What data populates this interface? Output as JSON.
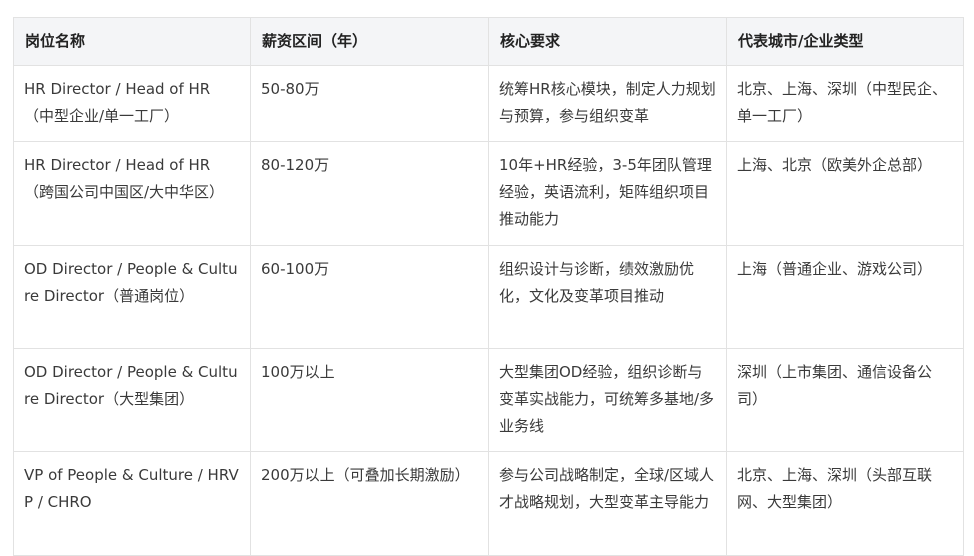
{
  "table": {
    "headers": [
      "岗位名称",
      "薪资区间（年）",
      "核心要求",
      "代表城市/企业类型"
    ],
    "rows": [
      [
        "HR Director / Head of HR（中型企业/单一工厂）",
        "50-80万",
        "统筹HR核心模块，制定人力规划与预算，参与组织变革",
        "北京、上海、深圳（中型民企、单一工厂）"
      ],
      [
        "HR Director / Head of HR（跨国公司中国区/大中华区）",
        "80-120万",
        "10年+HR经验，3-5年团队管理经验，英语流利，矩阵组织项目推动能力",
        "上海、北京（欧美外企总部）"
      ],
      [
        "OD Director / People & Culture Director（普通岗位）",
        "60-100万",
        "组织设计与诊断，绩效激励优化，文化及变革项目推动",
        "上海（普通企业、游戏公司）"
      ],
      [
        "OD Director / People & Culture Director（大型集团）",
        "100万以上",
        "大型集团OD经验，组织诊断与变革实战能力，可统筹多基地/多业务线",
        "深圳（上市集团、通信设备公司）"
      ],
      [
        "VP of People & Culture / HRVP / CHRO",
        "200万以上（可叠加长期激励）",
        "参与公司战略制定，全球/区域人才战略规划，大型变革主导能力",
        "北京、上海、深圳（头部互联网、大型集团）"
      ]
    ]
  }
}
